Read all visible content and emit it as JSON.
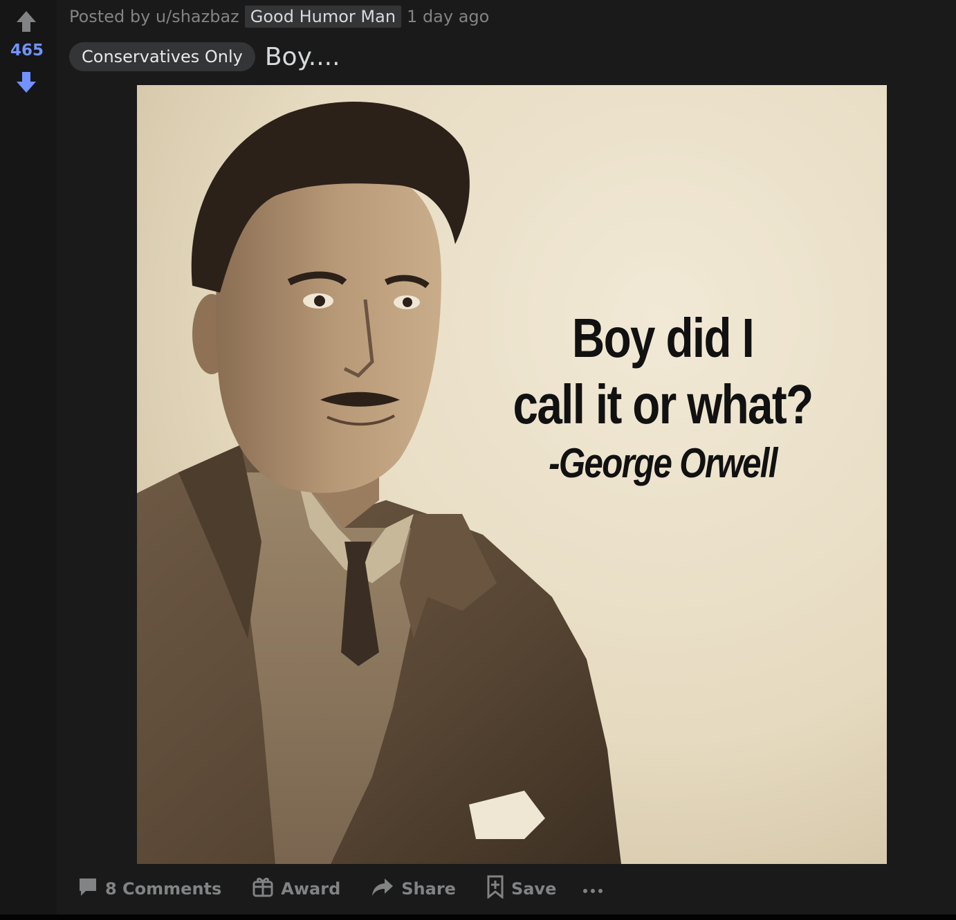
{
  "vote": {
    "score": "465",
    "up_icon": "arrow-up-icon",
    "down_icon": "arrow-down-icon",
    "score_color": "#7193ff"
  },
  "meta": {
    "posted_by": "Posted by u/shazbaz",
    "user_flair": "Good Humor Man",
    "time": "1 day ago"
  },
  "post": {
    "flair": "Conservatives Only",
    "title": "Boy...."
  },
  "image": {
    "quote_line1": "Boy did I",
    "quote_line2": "call it or what?",
    "quote_author": "-George Orwell",
    "background_color": "#e8dcc4"
  },
  "actions": {
    "comments": "8 Comments",
    "award": "Award",
    "share": "Share",
    "save": "Save",
    "comments_icon": "comment-icon",
    "award_icon": "gift-icon",
    "share_icon": "share-arrow-icon",
    "save_icon": "bookmark-plus-icon",
    "more_icon": "more-dots-icon"
  }
}
